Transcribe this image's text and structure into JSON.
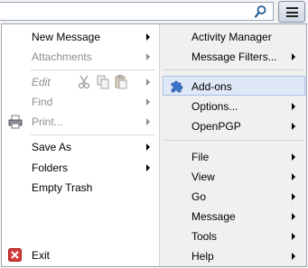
{
  "toolbar": {
    "search_icon": "magnifier-icon",
    "menu_icon": "hamburger-menu-icon"
  },
  "left_menu": {
    "new_message": "New Message",
    "attachments": "Attachments",
    "edit": "Edit",
    "find": "Find",
    "print": "Print...",
    "save_as": "Save As",
    "folders": "Folders",
    "empty_trash": "Empty Trash",
    "exit": "Exit"
  },
  "right_menu": {
    "activity_manager": "Activity Manager",
    "message_filters": "Message Filters...",
    "addons": "Add-ons",
    "options": "Options...",
    "openpgp": "OpenPGP",
    "file": "File",
    "view": "View",
    "go": "Go",
    "message": "Message",
    "tools": "Tools",
    "help": "Help"
  },
  "colors": {
    "highlight_bg": "#dfe8f6",
    "highlight_border": "#a9c0e3",
    "disabled_text": "#8d8d8d",
    "addons_icon": "#3b73c8",
    "exit_icon": "#d23b3b"
  }
}
